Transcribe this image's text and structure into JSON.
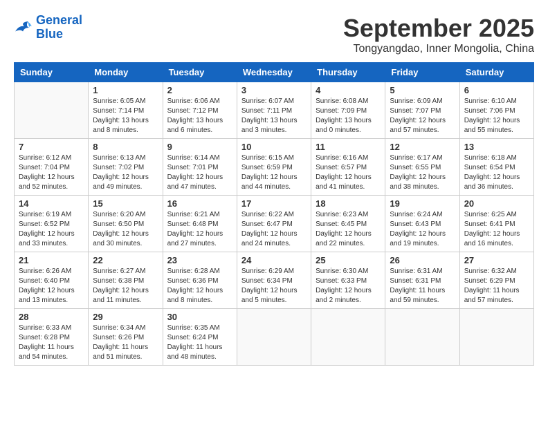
{
  "header": {
    "logo_line1": "General",
    "logo_line2": "Blue",
    "month": "September 2025",
    "location": "Tongyangdao, Inner Mongolia, China"
  },
  "weekdays": [
    "Sunday",
    "Monday",
    "Tuesday",
    "Wednesday",
    "Thursday",
    "Friday",
    "Saturday"
  ],
  "weeks": [
    [
      {
        "day": "",
        "info": ""
      },
      {
        "day": "1",
        "info": "Sunrise: 6:05 AM\nSunset: 7:14 PM\nDaylight: 13 hours\nand 8 minutes."
      },
      {
        "day": "2",
        "info": "Sunrise: 6:06 AM\nSunset: 7:12 PM\nDaylight: 13 hours\nand 6 minutes."
      },
      {
        "day": "3",
        "info": "Sunrise: 6:07 AM\nSunset: 7:11 PM\nDaylight: 13 hours\nand 3 minutes."
      },
      {
        "day": "4",
        "info": "Sunrise: 6:08 AM\nSunset: 7:09 PM\nDaylight: 13 hours\nand 0 minutes."
      },
      {
        "day": "5",
        "info": "Sunrise: 6:09 AM\nSunset: 7:07 PM\nDaylight: 12 hours\nand 57 minutes."
      },
      {
        "day": "6",
        "info": "Sunrise: 6:10 AM\nSunset: 7:06 PM\nDaylight: 12 hours\nand 55 minutes."
      }
    ],
    [
      {
        "day": "7",
        "info": "Sunrise: 6:12 AM\nSunset: 7:04 PM\nDaylight: 12 hours\nand 52 minutes."
      },
      {
        "day": "8",
        "info": "Sunrise: 6:13 AM\nSunset: 7:02 PM\nDaylight: 12 hours\nand 49 minutes."
      },
      {
        "day": "9",
        "info": "Sunrise: 6:14 AM\nSunset: 7:01 PM\nDaylight: 12 hours\nand 47 minutes."
      },
      {
        "day": "10",
        "info": "Sunrise: 6:15 AM\nSunset: 6:59 PM\nDaylight: 12 hours\nand 44 minutes."
      },
      {
        "day": "11",
        "info": "Sunrise: 6:16 AM\nSunset: 6:57 PM\nDaylight: 12 hours\nand 41 minutes."
      },
      {
        "day": "12",
        "info": "Sunrise: 6:17 AM\nSunset: 6:55 PM\nDaylight: 12 hours\nand 38 minutes."
      },
      {
        "day": "13",
        "info": "Sunrise: 6:18 AM\nSunset: 6:54 PM\nDaylight: 12 hours\nand 36 minutes."
      }
    ],
    [
      {
        "day": "14",
        "info": "Sunrise: 6:19 AM\nSunset: 6:52 PM\nDaylight: 12 hours\nand 33 minutes."
      },
      {
        "day": "15",
        "info": "Sunrise: 6:20 AM\nSunset: 6:50 PM\nDaylight: 12 hours\nand 30 minutes."
      },
      {
        "day": "16",
        "info": "Sunrise: 6:21 AM\nSunset: 6:48 PM\nDaylight: 12 hours\nand 27 minutes."
      },
      {
        "day": "17",
        "info": "Sunrise: 6:22 AM\nSunset: 6:47 PM\nDaylight: 12 hours\nand 24 minutes."
      },
      {
        "day": "18",
        "info": "Sunrise: 6:23 AM\nSunset: 6:45 PM\nDaylight: 12 hours\nand 22 minutes."
      },
      {
        "day": "19",
        "info": "Sunrise: 6:24 AM\nSunset: 6:43 PM\nDaylight: 12 hours\nand 19 minutes."
      },
      {
        "day": "20",
        "info": "Sunrise: 6:25 AM\nSunset: 6:41 PM\nDaylight: 12 hours\nand 16 minutes."
      }
    ],
    [
      {
        "day": "21",
        "info": "Sunrise: 6:26 AM\nSunset: 6:40 PM\nDaylight: 12 hours\nand 13 minutes."
      },
      {
        "day": "22",
        "info": "Sunrise: 6:27 AM\nSunset: 6:38 PM\nDaylight: 12 hours\nand 11 minutes."
      },
      {
        "day": "23",
        "info": "Sunrise: 6:28 AM\nSunset: 6:36 PM\nDaylight: 12 hours\nand 8 minutes."
      },
      {
        "day": "24",
        "info": "Sunrise: 6:29 AM\nSunset: 6:34 PM\nDaylight: 12 hours\nand 5 minutes."
      },
      {
        "day": "25",
        "info": "Sunrise: 6:30 AM\nSunset: 6:33 PM\nDaylight: 12 hours\nand 2 minutes."
      },
      {
        "day": "26",
        "info": "Sunrise: 6:31 AM\nSunset: 6:31 PM\nDaylight: 11 hours\nand 59 minutes."
      },
      {
        "day": "27",
        "info": "Sunrise: 6:32 AM\nSunset: 6:29 PM\nDaylight: 11 hours\nand 57 minutes."
      }
    ],
    [
      {
        "day": "28",
        "info": "Sunrise: 6:33 AM\nSunset: 6:28 PM\nDaylight: 11 hours\nand 54 minutes."
      },
      {
        "day": "29",
        "info": "Sunrise: 6:34 AM\nSunset: 6:26 PM\nDaylight: 11 hours\nand 51 minutes."
      },
      {
        "day": "30",
        "info": "Sunrise: 6:35 AM\nSunset: 6:24 PM\nDaylight: 11 hours\nand 48 minutes."
      },
      {
        "day": "",
        "info": ""
      },
      {
        "day": "",
        "info": ""
      },
      {
        "day": "",
        "info": ""
      },
      {
        "day": "",
        "info": ""
      }
    ]
  ]
}
